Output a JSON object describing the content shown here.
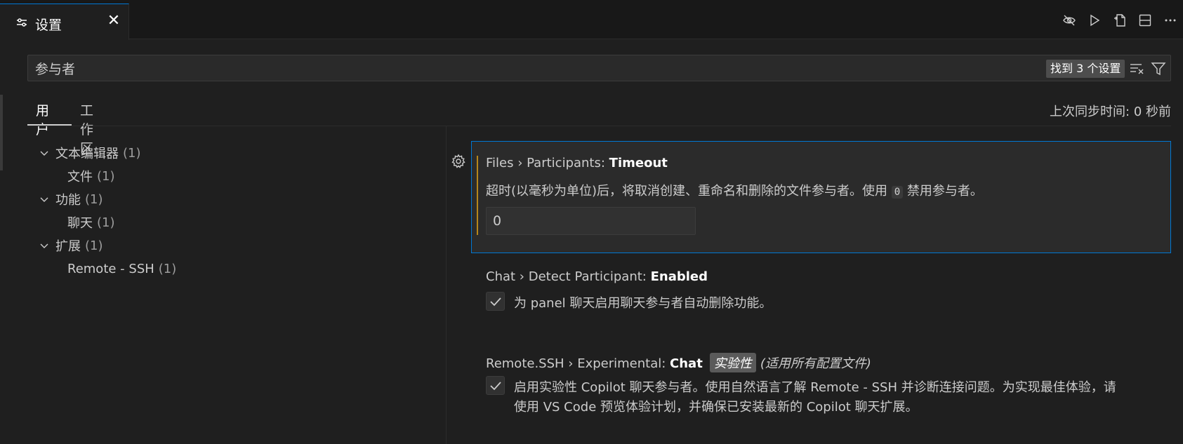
{
  "tab": {
    "title": "设置",
    "close": "✕"
  },
  "search": {
    "value": "参与者",
    "result_count": "找到 3 个设置"
  },
  "scope_tabs": {
    "user": "用户",
    "workspace": "工作区"
  },
  "sync_status": "上次同步时间: 0 秒前",
  "toc": [
    {
      "label": "文本编辑器",
      "count": "(1)"
    },
    {
      "label": "文件",
      "count": "(1)"
    },
    {
      "label": "功能",
      "count": "(1)"
    },
    {
      "label": "聊天",
      "count": "(1)"
    },
    {
      "label": "扩展",
      "count": "(1)"
    },
    {
      "label": "Remote - SSH",
      "count": "(1)"
    }
  ],
  "settings": [
    {
      "category": "Files › Participants: ",
      "key": "Timeout",
      "desc_before": "超时(以毫秒为单位)后，将取消创建、重命名和删除的文件参与者。使用 ",
      "code": "0",
      "desc_after": " 禁用参与者。",
      "value": "0"
    },
    {
      "category": "Chat › Detect Participant: ",
      "key": "Enabled",
      "desc": "为 panel 聊天启用聊天参与者自动删除功能。",
      "checked": true
    },
    {
      "category": "Remote.SSH › Experimental: ",
      "key": "Chat",
      "badge": "实验性",
      "scope": "(适用所有配置文件)",
      "desc_line1": "启用实验性 Copilot 聊天参与者。使用自然语言了解 Remote - SSH 并诊断连接问题。为实现最佳体验，请",
      "desc_line2": "使用 VS Code 预览体验计划，并确保已安装最新的 Copilot 聊天扩展。",
      "checked": true
    }
  ],
  "icons": [
    "settings-icon",
    "eye-closed-icon",
    "run-icon",
    "open-json-icon",
    "split-editor-icon",
    "more-icon",
    "clear-filter-icon",
    "filter-icon",
    "chevron-down-icon",
    "gear-icon",
    "check-icon"
  ]
}
